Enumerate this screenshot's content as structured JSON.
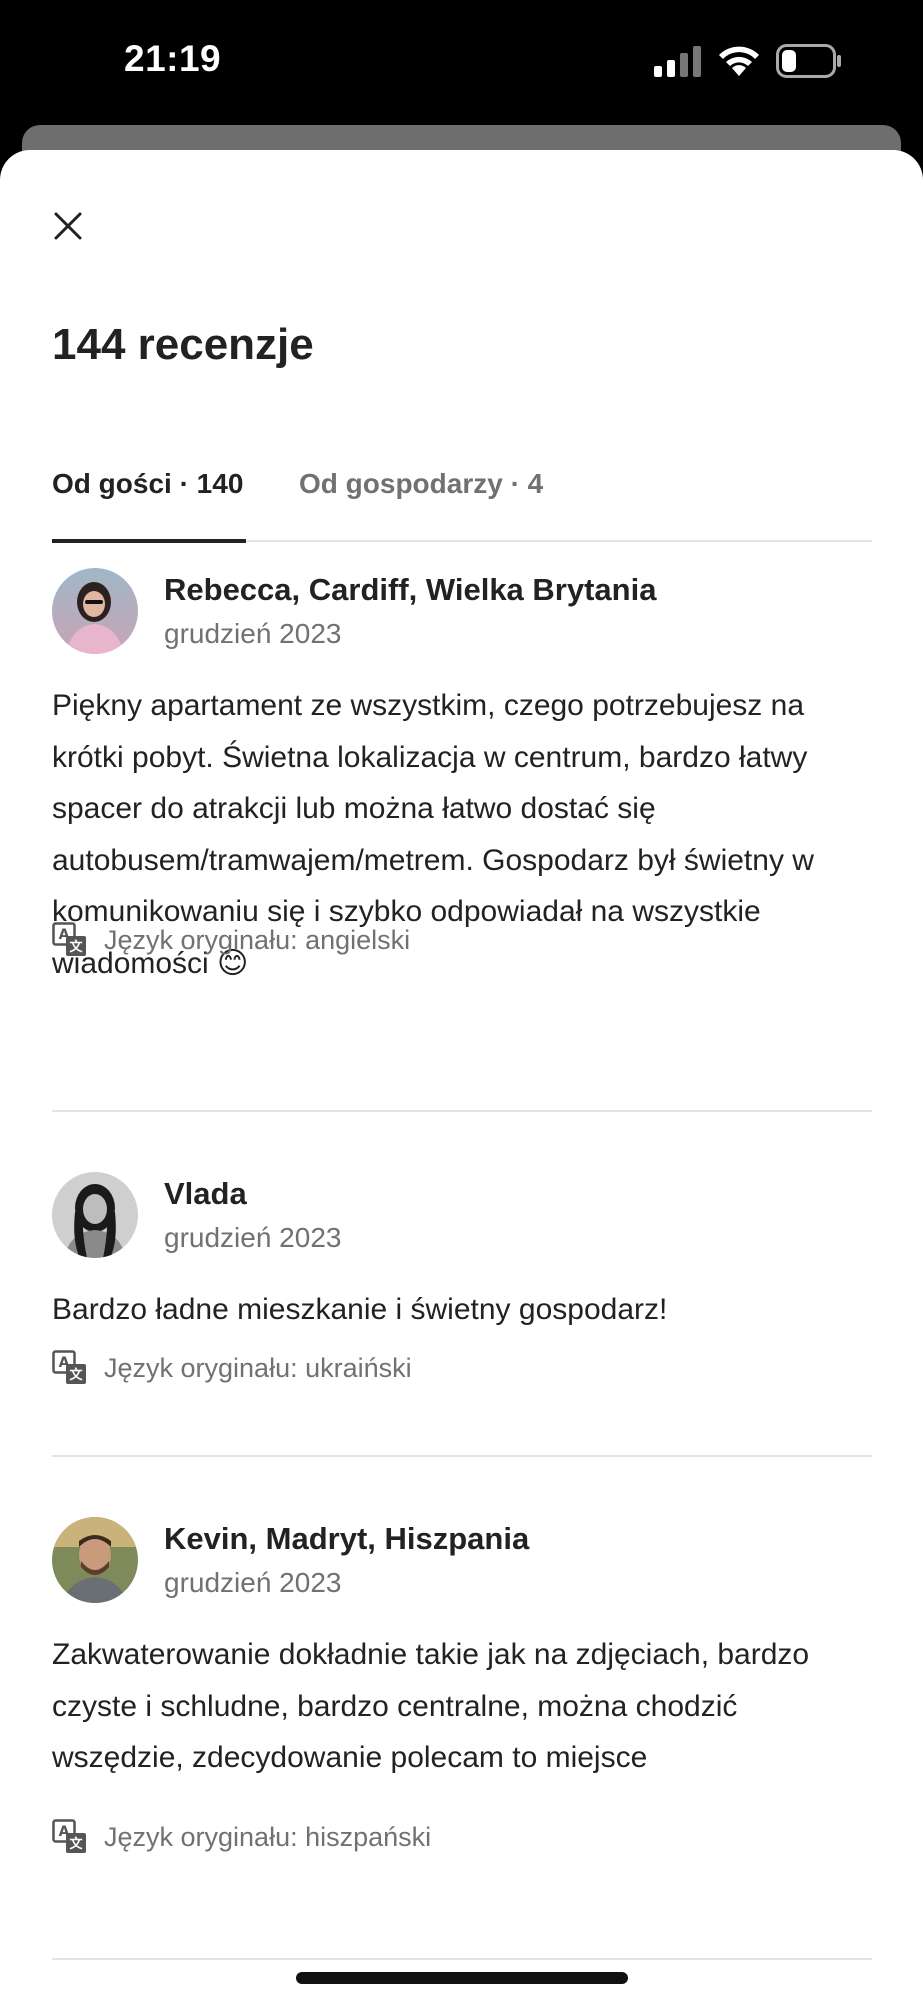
{
  "status_bar": {
    "time": "21:19",
    "icons": [
      "cellular-signal-icon",
      "wifi-icon",
      "battery-icon"
    ]
  },
  "header": {
    "close_icon": "close-icon",
    "title": "144 recenzje"
  },
  "tabs": [
    {
      "label": "Od gości · 140",
      "active": true
    },
    {
      "label": "Od gospodarzy · 4",
      "active": false
    }
  ],
  "reviews": [
    {
      "name": "Rebecca, Cardiff, Wielka Brytania",
      "date": "grudzień 2023",
      "text": "Piękny apartament ze wszystkim, czego potrzebujesz na krótki pobyt. Świetna lokalizacja w centrum, bardzo łatwy spacer do atrakcji lub można łatwo dostać się autobusem/tramwajem/metrem. Gospodarz był świetny w komunikowaniu się i szybko odpowiadał na wszystkie wiadomości 😊",
      "language": "Język oryginału: angielski"
    },
    {
      "name": "Vlada",
      "date": "grudzień 2023",
      "text": "Bardzo ładne mieszkanie i świetny gospodarz!",
      "language": "Język oryginału: ukraiński"
    },
    {
      "name": "Kevin, Madryt, Hiszpania",
      "date": "grudzień 2023",
      "text": "Zakwaterowanie dokładnie takie jak na zdjęciach, bardzo czyste i schludne, bardzo centralne, można chodzić wszędzie, zdecydowanie polecam to miejsce",
      "language": "Język oryginału: hiszpański"
    }
  ],
  "colors": {
    "text_primary": "#222222",
    "text_secondary": "#717171",
    "divider": "#e4e4e4",
    "background": "#ffffff"
  }
}
